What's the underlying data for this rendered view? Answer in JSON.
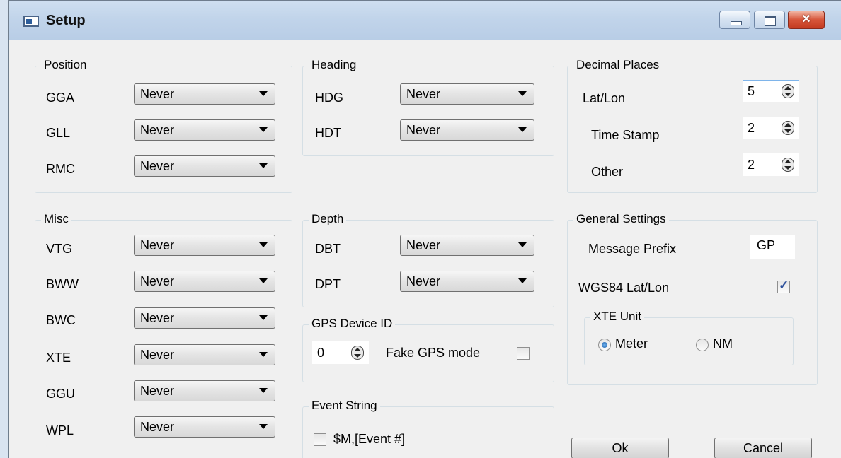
{
  "window": {
    "title": "Setup"
  },
  "titlebar": {
    "close_glyph": "✕"
  },
  "groups": {
    "position": {
      "title": "Position",
      "rows": [
        {
          "label": "GGA",
          "value": "Never"
        },
        {
          "label": "GLL",
          "value": "Never"
        },
        {
          "label": "RMC",
          "value": "Never"
        }
      ]
    },
    "heading": {
      "title": "Heading",
      "rows": [
        {
          "label": "HDG",
          "value": "Never"
        },
        {
          "label": "HDT",
          "value": "Never"
        }
      ]
    },
    "decimal_places": {
      "title": "Decimal Places",
      "rows": [
        {
          "label": "Lat/Lon",
          "value": "5"
        },
        {
          "label": "Time Stamp",
          "value": "2"
        },
        {
          "label": "Other",
          "value": "2"
        }
      ]
    },
    "misc": {
      "title": "Misc",
      "rows": [
        {
          "label": "VTG",
          "value": "Never"
        },
        {
          "label": "BWW",
          "value": "Never"
        },
        {
          "label": "BWC",
          "value": "Never"
        },
        {
          "label": "XTE",
          "value": "Never"
        },
        {
          "label": "GGU",
          "value": "Never"
        },
        {
          "label": "WPL",
          "value": "Never"
        }
      ]
    },
    "depth": {
      "title": "Depth",
      "rows": [
        {
          "label": "DBT",
          "value": "Never"
        },
        {
          "label": "DPT",
          "value": "Never"
        }
      ]
    },
    "gps_device": {
      "title": "GPS Device ID",
      "device_id": "0",
      "fake_mode_label": "Fake GPS mode",
      "fake_mode_checked": false
    },
    "event_string": {
      "title": "Event String",
      "checkbox_label": "$M,[Event #]",
      "checked": false
    },
    "general": {
      "title": "General Settings",
      "prefix_label": "Message Prefix",
      "prefix_value": "GP",
      "wgs84_label": "WGS84 Lat/Lon",
      "wgs84_checked": true,
      "xte_unit": {
        "title": "XTE Unit",
        "options": [
          "Meter",
          "NM"
        ],
        "selected": "Meter"
      }
    }
  },
  "buttons": {
    "ok": "Ok",
    "cancel": "Cancel"
  }
}
